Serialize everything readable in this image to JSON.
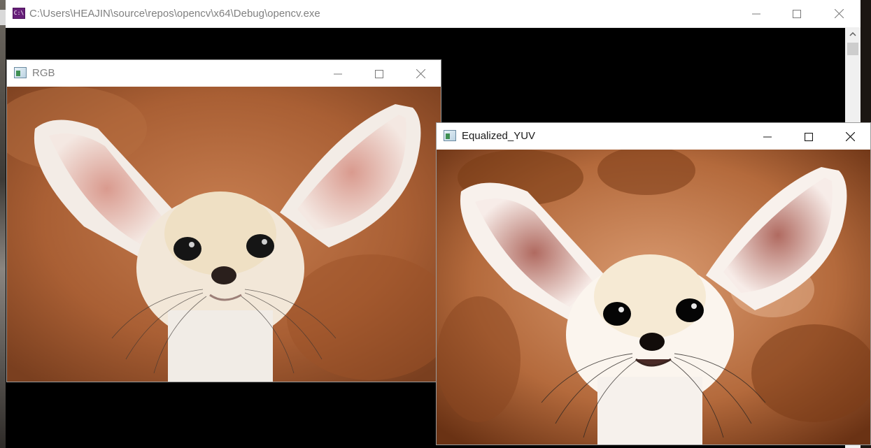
{
  "console": {
    "title": "C:\\Users\\HEAJIN\\source\\repos\\opencv\\x64\\Debug\\opencv.exe",
    "icon": "C:\\"
  },
  "windows": {
    "rgb": {
      "title": "RGB",
      "image_description": "fennec-fox"
    },
    "yuv": {
      "title": "Equalized_YUV",
      "image_description": "fennec-fox-equalized"
    }
  },
  "controls": {
    "minimize": "minimize-icon",
    "maximize": "maximize-icon",
    "close": "close-icon"
  },
  "colors": {
    "console_background": "#000000",
    "rgb_background": "#b56a3c",
    "yuv_background": "#c8865a"
  }
}
